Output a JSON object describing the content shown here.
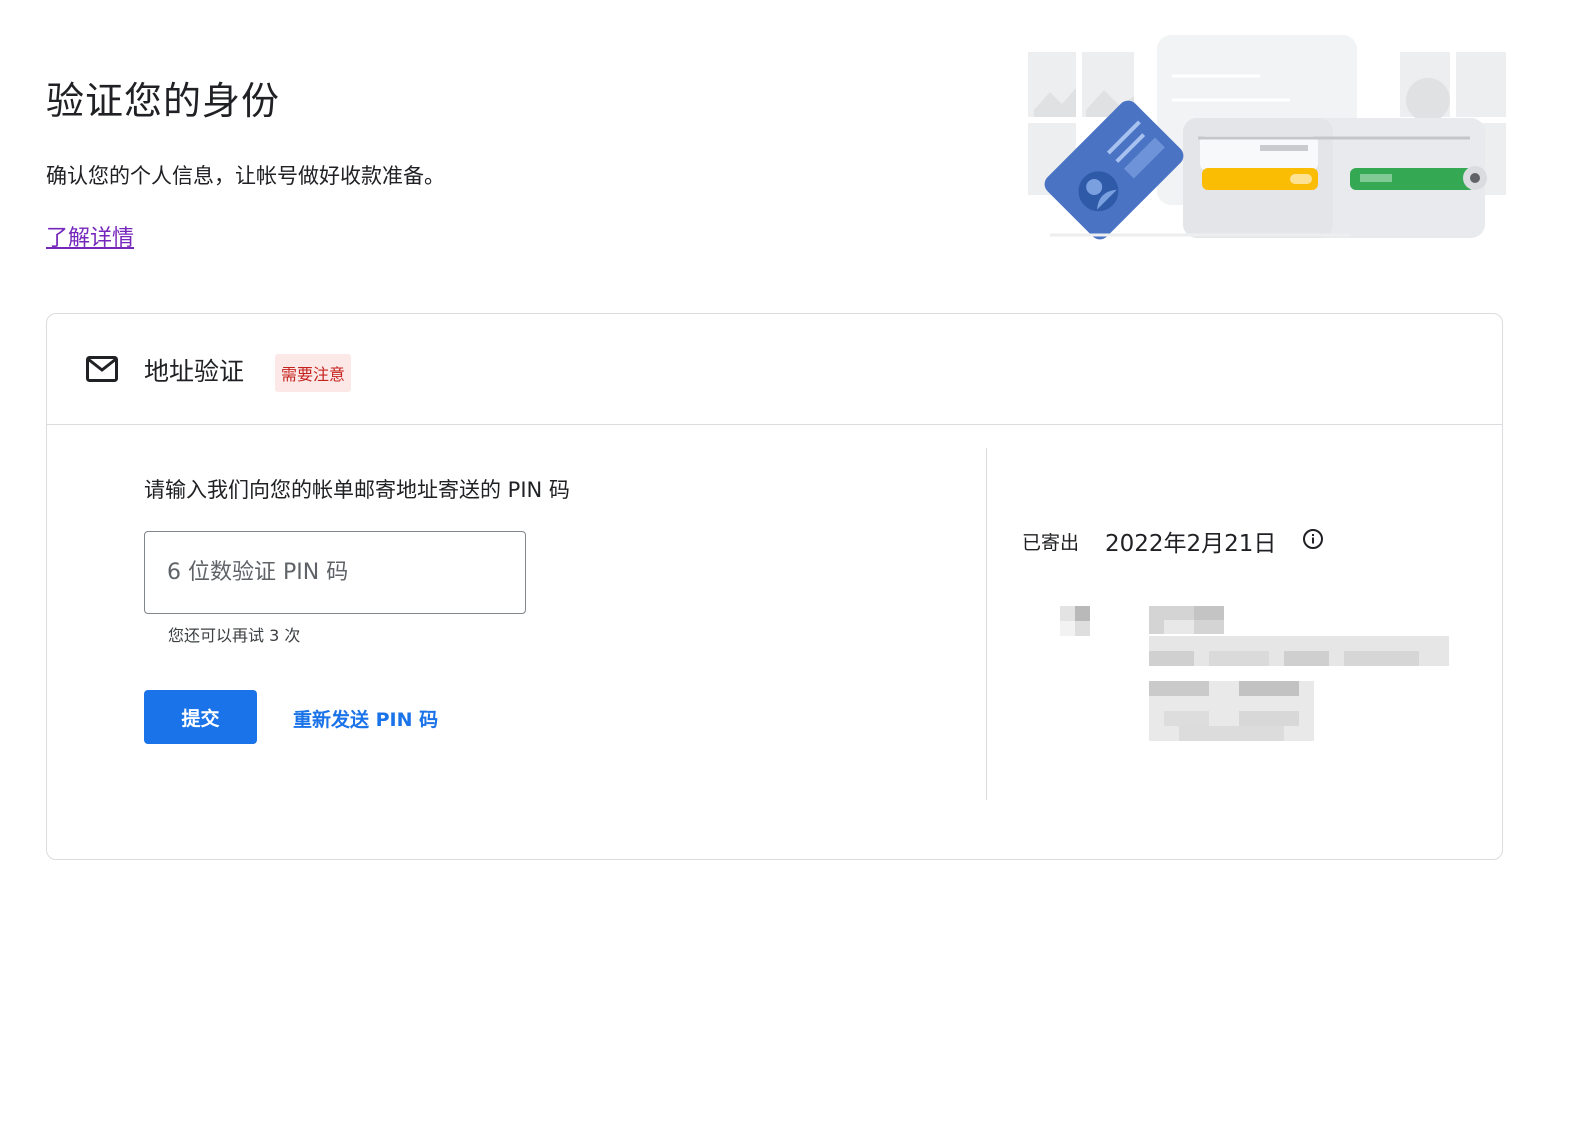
{
  "page": {
    "title": "验证您的身份",
    "subtitle": "确认您的个人信息，让帐号做好收款准备。",
    "learn_more": "了解详情"
  },
  "card": {
    "title": "地址验证",
    "badge": "需要注意",
    "prompt": "请输入我们向您的帐单邮寄地址寄送的 PIN 码",
    "pin_placeholder": "6 位数验证 PIN 码",
    "pin_value": "",
    "retries": "您还可以再试 3 次",
    "submit_label": "提交",
    "resend_label": "重新发送 PIN 码",
    "sent_label": "已寄出",
    "sent_date": "2022年2月21日"
  },
  "icons": {
    "mail": "mail-icon",
    "info": "info-icon"
  },
  "colors": {
    "primary": "#1a73e8",
    "link_visited": "#7627bb",
    "badge_bg": "#fce8e6",
    "badge_text": "#c5221f"
  }
}
